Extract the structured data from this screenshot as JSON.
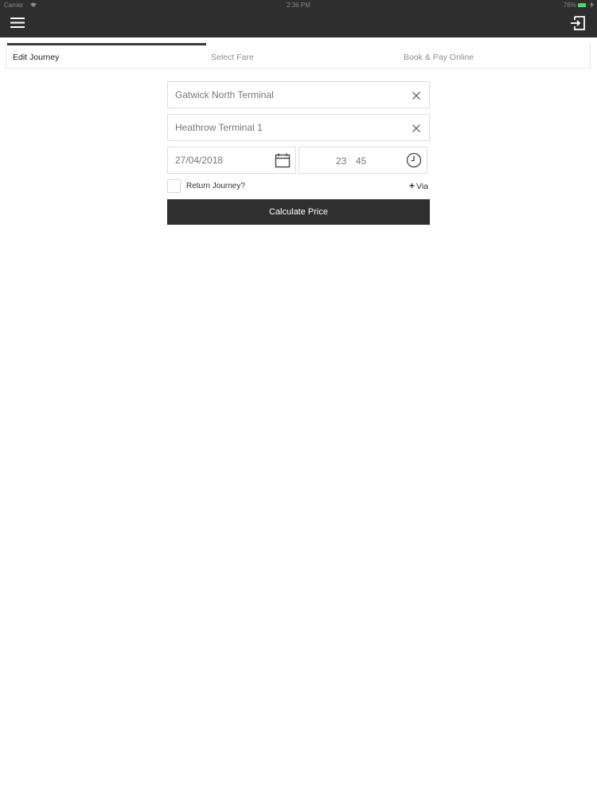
{
  "status_bar": {
    "carrier": "Carrier",
    "time": "2:36 PM",
    "battery": "76%"
  },
  "header": {
    "menu_icon": "hamburger-icon",
    "logout_icon": "logout-icon"
  },
  "tabs": [
    {
      "label": "Edit Journey",
      "active": true
    },
    {
      "label": "Select Fare",
      "active": false
    },
    {
      "label": "Book & Pay Online",
      "active": false
    }
  ],
  "form": {
    "pickup": "Gatwick North Terminal",
    "dropoff": "Heathrow Terminal 1",
    "date": "27/04/2018",
    "hour": "23",
    "minute": "45",
    "return_label": "Return Journey?",
    "return_checked": false,
    "via_label": "Via",
    "calculate_label": "Calculate Price"
  },
  "colors": {
    "header_bg": "#2e2e2e",
    "button_bg": "#2f2f2f",
    "battery": "#4cd964"
  }
}
